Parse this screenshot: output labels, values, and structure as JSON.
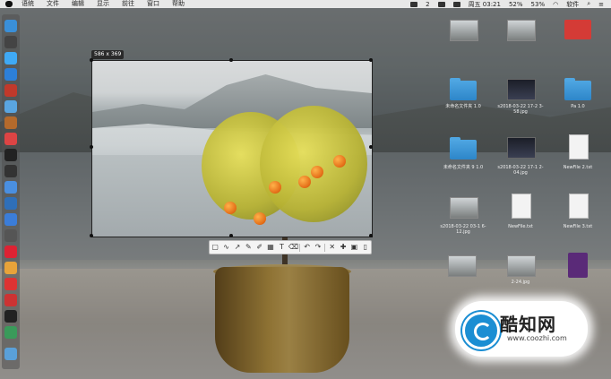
{
  "menubar": {
    "items": [
      "语统",
      "文件",
      "编辑",
      "显示",
      "前往",
      "窗口",
      "帮助"
    ],
    "status": {
      "badge": "2",
      "day_time": "周五 03:21",
      "battery_percent": "52%",
      "battery2_percent": "53%",
      "ime": "软件"
    }
  },
  "selection": {
    "size_label": "586 x 369"
  },
  "toolbar": {
    "icons": [
      "rect-select-icon",
      "curve-icon",
      "arrow-icon",
      "pencil-icon",
      "highlighter-icon",
      "mosaic-icon",
      "text-icon",
      "eraser-icon",
      "undo-icon",
      "redo-icon",
      "close-icon",
      "pin-icon",
      "save-icon",
      "copy-icon"
    ],
    "glyphs": [
      "▢",
      "∿",
      "↗",
      "✎",
      "✐",
      "▦",
      "T",
      "⌫",
      "↶",
      "↷",
      "✕",
      "✚",
      "▣",
      "▯"
    ]
  },
  "desktop": {
    "labels": [
      "",
      "",
      "",
      "未命名文件夹 1.0",
      "s2018-03-22 17-2 3-58.jpg",
      "Pa 1.0",
      "未命名文件夹 9 1.0",
      "s2018-03-22 17-1 2-04.jpg",
      "NewFile 2.txt",
      "s2018-03-22 03-1 6-12.jpg",
      "NewFile.txt",
      "NewFile 3.txt",
      "",
      "2-24.jpg",
      ""
    ]
  },
  "watermark": {
    "title": "酷知网",
    "url": "www.coozhi.com"
  }
}
